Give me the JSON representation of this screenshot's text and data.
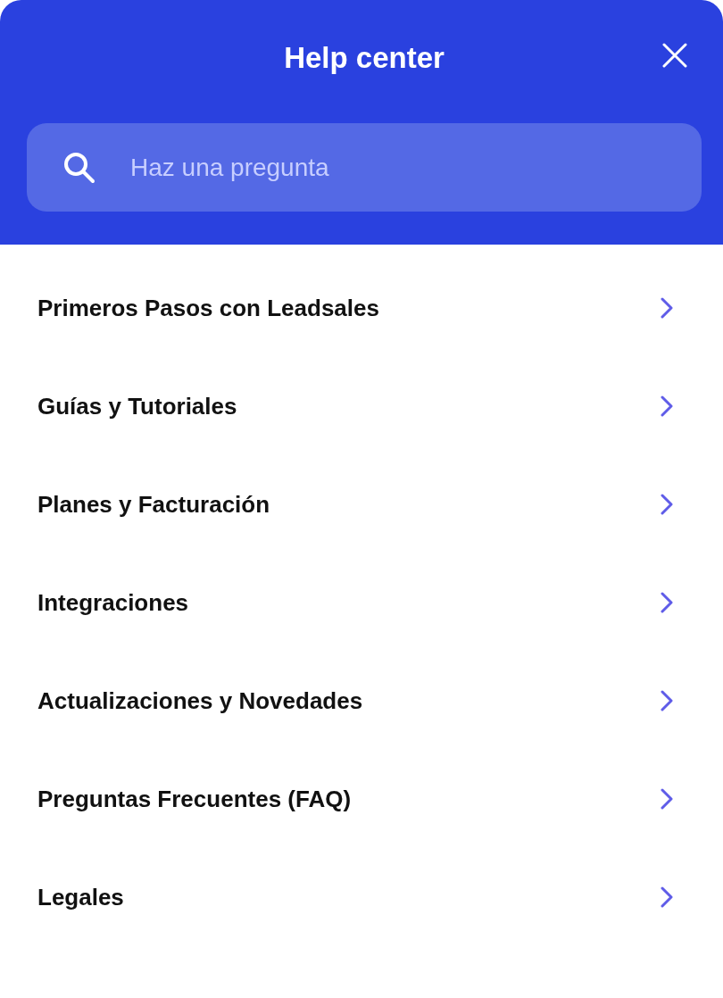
{
  "header": {
    "title": "Help center"
  },
  "search": {
    "placeholder": "Haz una pregunta"
  },
  "categories": [
    {
      "label": "Primeros Pasos con Leadsales"
    },
    {
      "label": "Guías y Tutoriales"
    },
    {
      "label": "Planes y Facturación"
    },
    {
      "label": "Integraciones"
    },
    {
      "label": "Actualizaciones y Novedades"
    },
    {
      "label": "Preguntas Frecuentes (FAQ)"
    },
    {
      "label": "Legales"
    }
  ]
}
